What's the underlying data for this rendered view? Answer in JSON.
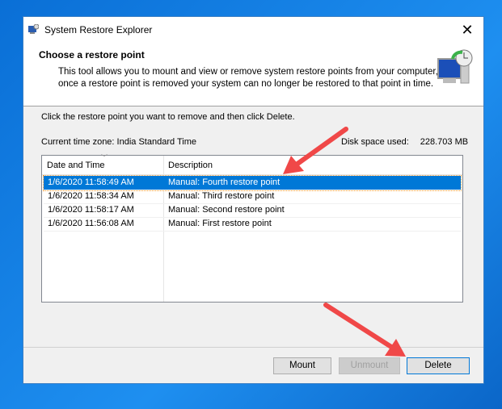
{
  "window": {
    "title": "System Restore Explorer",
    "close": "✕"
  },
  "header": {
    "heading": "Choose a restore point",
    "desc_line1": "This tool allows you to mount and view or remove system restore points from your computer,",
    "desc_line2": "once a restore point is removed your system can no longer be restored to that point in time."
  },
  "instruction": "Click the restore point you want to remove and then click Delete.",
  "timezone": {
    "label": "Current time zone:",
    "value": "India Standard Time"
  },
  "disk": {
    "label": "Disk space used:",
    "value": "228.703 MB"
  },
  "list": {
    "columns": [
      "Date and Time",
      "Description"
    ],
    "rows": [
      {
        "date": "1/6/2020 11:58:49 AM",
        "desc": "Manual: Fourth restore point"
      },
      {
        "date": "1/6/2020 11:58:34 AM",
        "desc": "Manual: Third restore point"
      },
      {
        "date": "1/6/2020 11:58:17 AM",
        "desc": "Manual: Second restore point"
      },
      {
        "date": "1/6/2020 11:56:08 AM",
        "desc": "Manual: First restore point"
      }
    ]
  },
  "buttons": {
    "mount": "Mount",
    "unmount": "Unmount",
    "delete": "Delete"
  },
  "colors": {
    "selection": "#0078d7",
    "arrow": "#f04848"
  }
}
